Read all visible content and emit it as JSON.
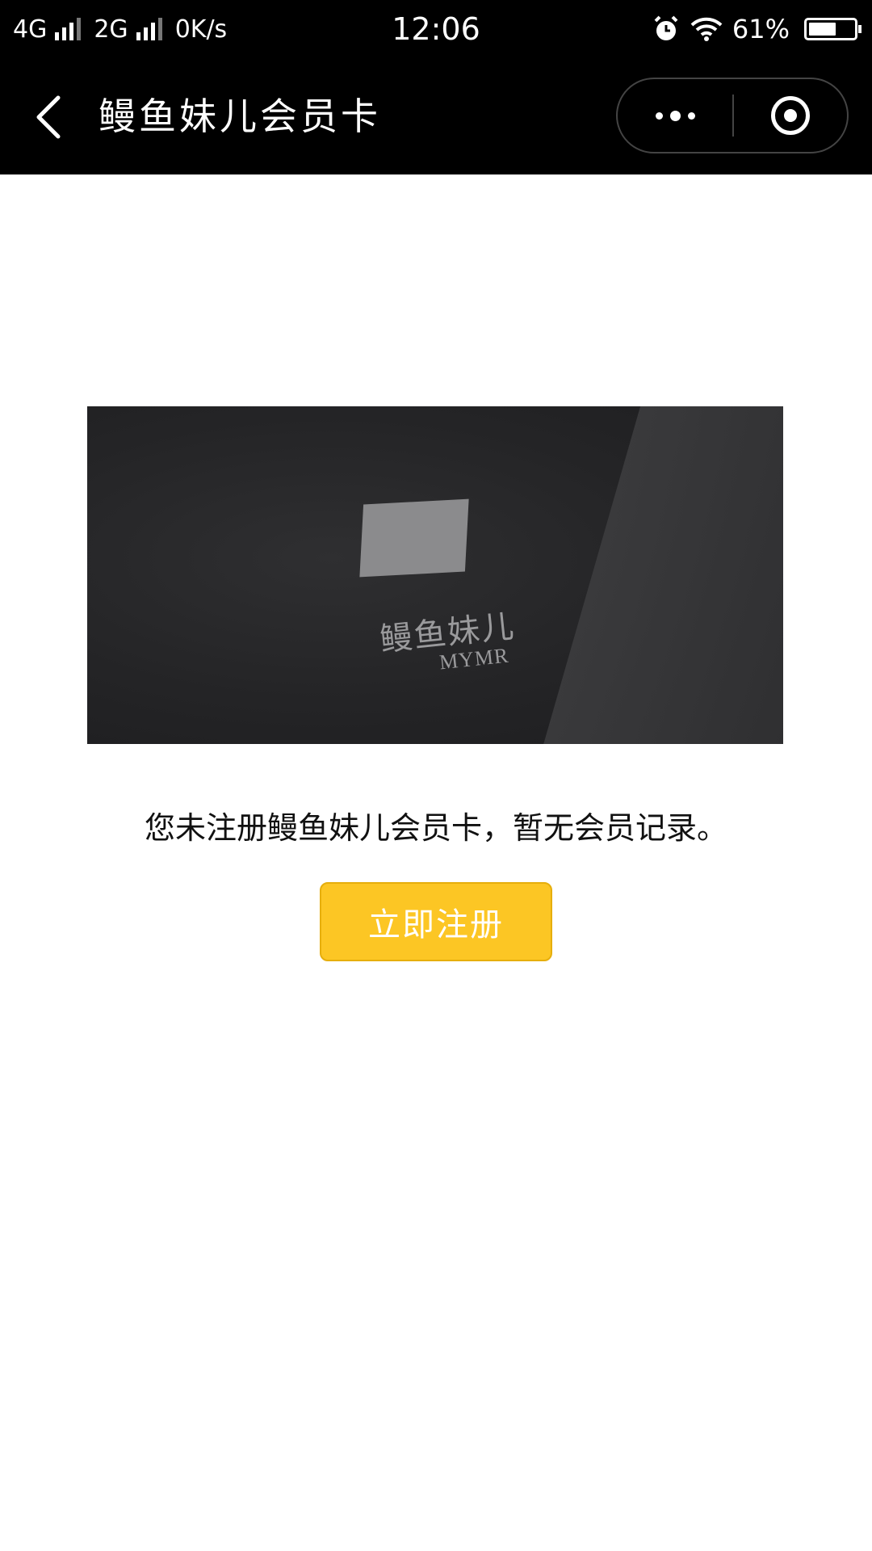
{
  "status_bar": {
    "network_1": "4G",
    "network_2": "2G",
    "speed": "0K/s",
    "time": "12:06",
    "battery_percent": "61%",
    "battery_level": 0.61,
    "icons": [
      "signal-icon",
      "alarm-icon",
      "wifi-icon",
      "battery-icon"
    ]
  },
  "nav": {
    "title": "鳗鱼妹儿会员卡",
    "back_icon": "chevron-left-icon",
    "menu_icon": "more-dots-icon",
    "close_icon": "target-close-icon"
  },
  "card": {
    "brand_cn": "鳗鱼妹儿",
    "brand_en": "MYMR"
  },
  "notice": "您未注册鳗鱼妹儿会员卡，暂无会员记录。",
  "register_button": "立即注册",
  "colors": {
    "bar_bg": "#000000",
    "button_bg": "#fcc624",
    "page_bg": "#ffffff"
  }
}
